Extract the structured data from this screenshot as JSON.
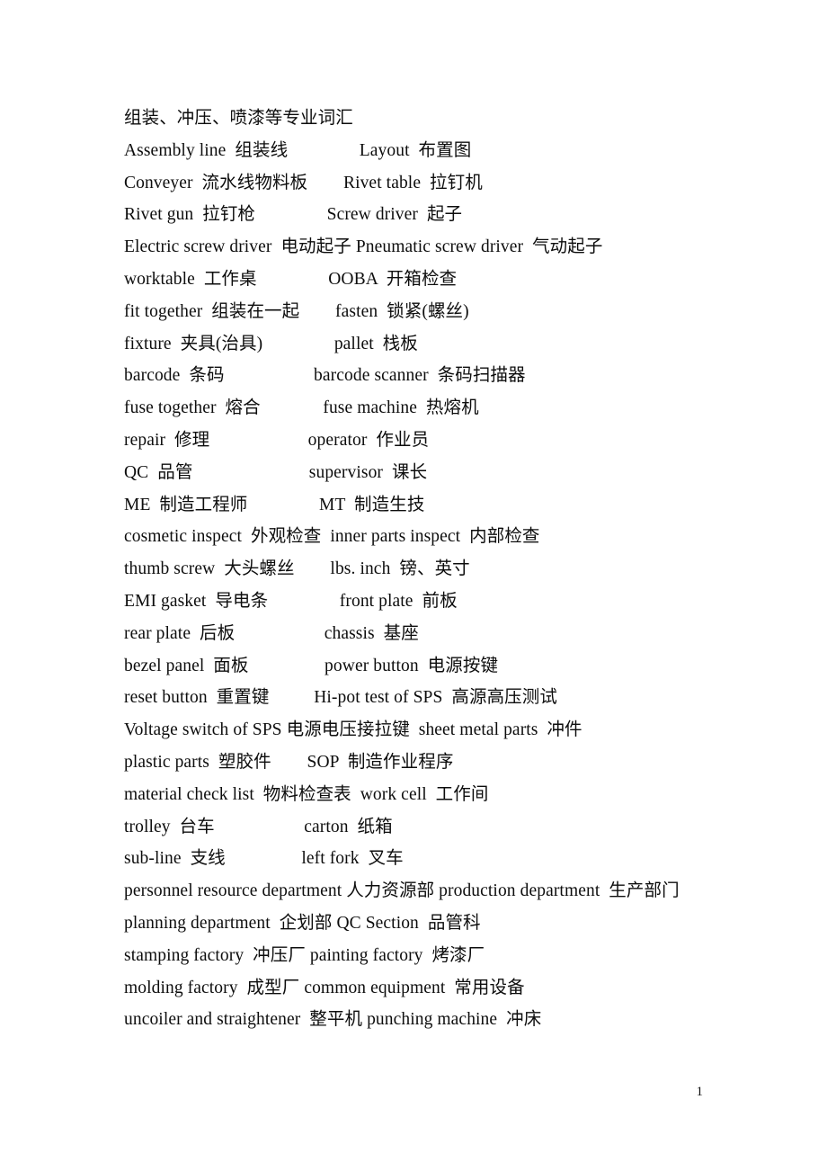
{
  "document": {
    "title": "组装、冲压、喷漆等专业词汇",
    "page_number": "1",
    "lines": [
      "组装、冲压、喷漆等专业词汇",
      "Assembly line  组装线                Layout  布置图",
      "Conveyer  流水线物料板        Rivet table  拉钉机",
      "Rivet gun  拉钉枪                Screw driver  起子",
      "Electric screw driver  电动起子 Pneumatic screw driver  气动起子",
      "worktable  工作桌                OOBA  开箱检查",
      "fit together  组装在一起        fasten  锁紧(螺丝)",
      "fixture  夹具(治具)                pallet  栈板",
      "barcode  条码                    barcode scanner  条码扫描器",
      "fuse together  熔合              fuse machine  热熔机",
      "repair  修理                      operator  作业员",
      "QC  品管                          supervisor  课长",
      "ME  制造工程师                MT  制造生技",
      "cosmetic inspect  外观检查  inner parts inspect  内部检查",
      "thumb screw  大头螺丝        lbs. inch  镑、英寸",
      "EMI gasket  导电条                front plate  前板",
      "rear plate  后板                    chassis  基座",
      "bezel panel  面板                 power button  电源按键",
      "reset button  重置键          Hi-pot test of SPS  高源高压测试",
      "Voltage switch of SPS 电源电压接拉键  sheet metal parts  冲件",
      "plastic parts  塑胶件        SOP  制造作业程序",
      "material check list  物料检查表  work cell  工作间",
      "trolley  台车                    carton  纸箱",
      "sub-line  支线                 left fork  叉车",
      "personnel resource department 人力资源部 production department  生产部门",
      "planning department  企划部 QC Section  品管科",
      "stamping factory  冲压厂 painting factory  烤漆厂",
      "molding factory  成型厂 common equipment  常用设备",
      "uncoiler and straightener  整平机 punching machine  冲床"
    ]
  }
}
